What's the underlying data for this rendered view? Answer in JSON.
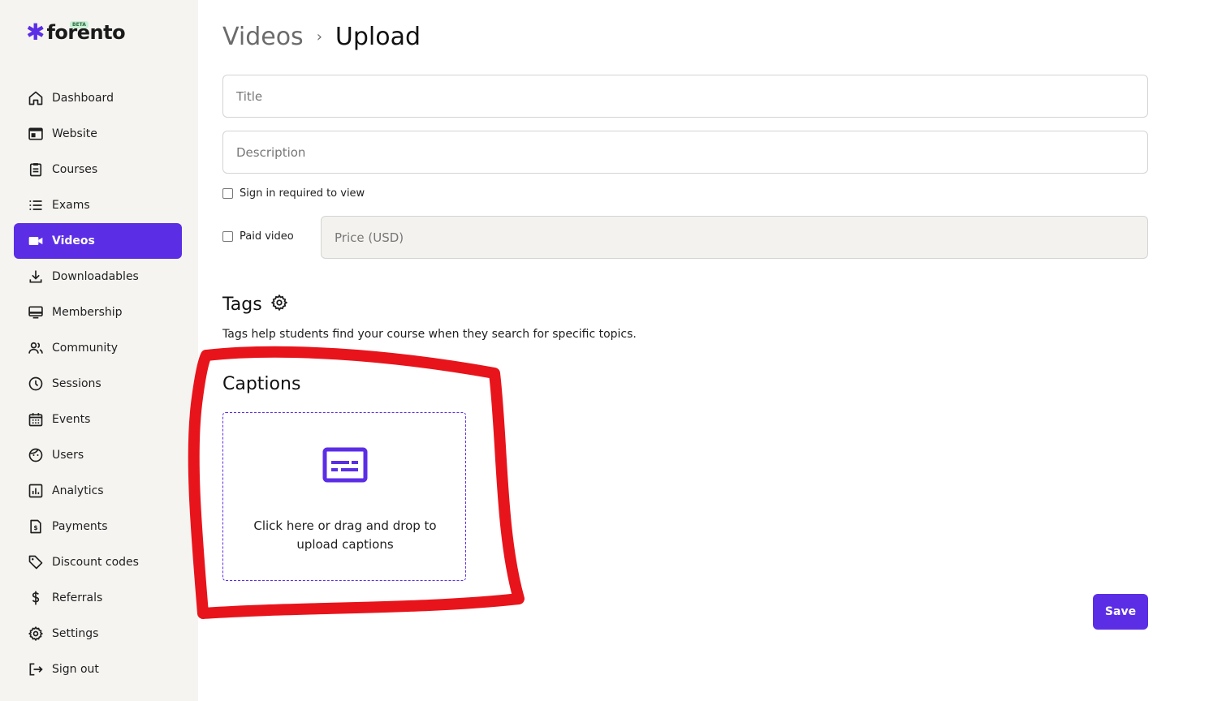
{
  "brand": {
    "name": "forento",
    "badge": "BETA",
    "accent": "#5b2ee6"
  },
  "sidebar": {
    "items": [
      {
        "label": "Dashboard",
        "icon": "home-icon"
      },
      {
        "label": "Website",
        "icon": "browser-icon"
      },
      {
        "label": "Courses",
        "icon": "clipboard-icon"
      },
      {
        "label": "Exams",
        "icon": "list-icon"
      },
      {
        "label": "Videos",
        "icon": "video-camera-icon",
        "active": true
      },
      {
        "label": "Downloadables",
        "icon": "download-icon"
      },
      {
        "label": "Membership",
        "icon": "card-icon"
      },
      {
        "label": "Community",
        "icon": "people-icon"
      },
      {
        "label": "Sessions",
        "icon": "clock-icon"
      },
      {
        "label": "Events",
        "icon": "calendar-icon"
      },
      {
        "label": "Users",
        "icon": "face-icon"
      },
      {
        "label": "Analytics",
        "icon": "bar-chart-icon"
      },
      {
        "label": "Payments",
        "icon": "invoice-icon"
      },
      {
        "label": "Discount codes",
        "icon": "tag-icon"
      },
      {
        "label": "Referrals",
        "icon": "dollar-icon"
      },
      {
        "label": "Settings",
        "icon": "gear-icon"
      },
      {
        "label": "Sign out",
        "icon": "sign-out-icon"
      }
    ]
  },
  "breadcrumb": {
    "parent": "Videos",
    "separator": "›",
    "current": "Upload"
  },
  "form": {
    "title_placeholder": "Title",
    "description_placeholder": "Description",
    "sign_in_label": "Sign in required to view",
    "paid_label": "Paid video",
    "price_placeholder": "Price (USD)"
  },
  "tags": {
    "title": "Tags",
    "description": "Tags help students find your course when they search for specific topics."
  },
  "captions": {
    "title": "Captions",
    "upload_text": "Click here or drag and drop to upload captions"
  },
  "actions": {
    "save_label": "Save"
  },
  "annotation": {
    "color": "#e8141b"
  }
}
